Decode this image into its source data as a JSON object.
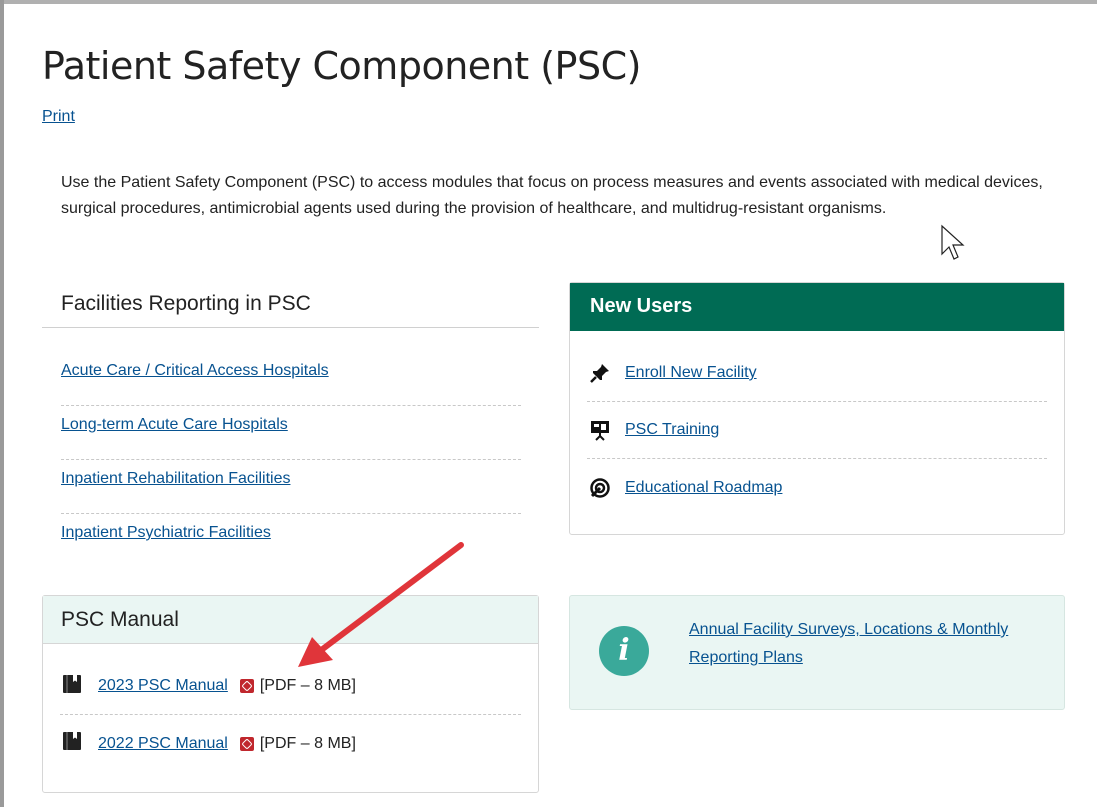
{
  "page": {
    "title": "Patient Safety Component (PSC)",
    "print_label": "Print",
    "intro": "Use the Patient Safety Component (PSC) to access modules that focus on process measures and events associated with medical devices, surgical procedures, antimicrobial agents used during the provision of healthcare, and multidrug-resistant organisms."
  },
  "facilities": {
    "heading": "Facilities Reporting in PSC",
    "items": [
      {
        "label": "Acute Care / Critical Access Hospitals"
      },
      {
        "label": "Long-term Acute Care Hospitals"
      },
      {
        "label": "Inpatient Rehabilitation Facilities"
      },
      {
        "label": "Inpatient Psychiatric Facilities"
      }
    ]
  },
  "new_users": {
    "heading": "New Users",
    "items": [
      {
        "label": "Enroll New Facility",
        "icon": "pushpin-icon"
      },
      {
        "label": "PSC Training",
        "icon": "presentation-icon"
      },
      {
        "label": "Educational Roadmap",
        "icon": "roadmap-icon"
      }
    ]
  },
  "manual": {
    "heading": "PSC Manual",
    "items": [
      {
        "label": "2023 PSC Manual",
        "meta": "[PDF – 8 MB]",
        "icon": "book-icon"
      },
      {
        "label": "2022 PSC Manual",
        "meta": "[PDF – 8 MB]",
        "icon": "book-icon"
      }
    ]
  },
  "info": {
    "icon": "info-icon",
    "link_label": "Annual Facility Surveys, Locations & Monthly Reporting Plans"
  },
  "colors": {
    "header_green": "#006b54",
    "link_blue": "#075290",
    "panel_tint": "#eaf6f3",
    "annotation_arrow": "#e0353a",
    "pdf_red": "#c0272d"
  }
}
